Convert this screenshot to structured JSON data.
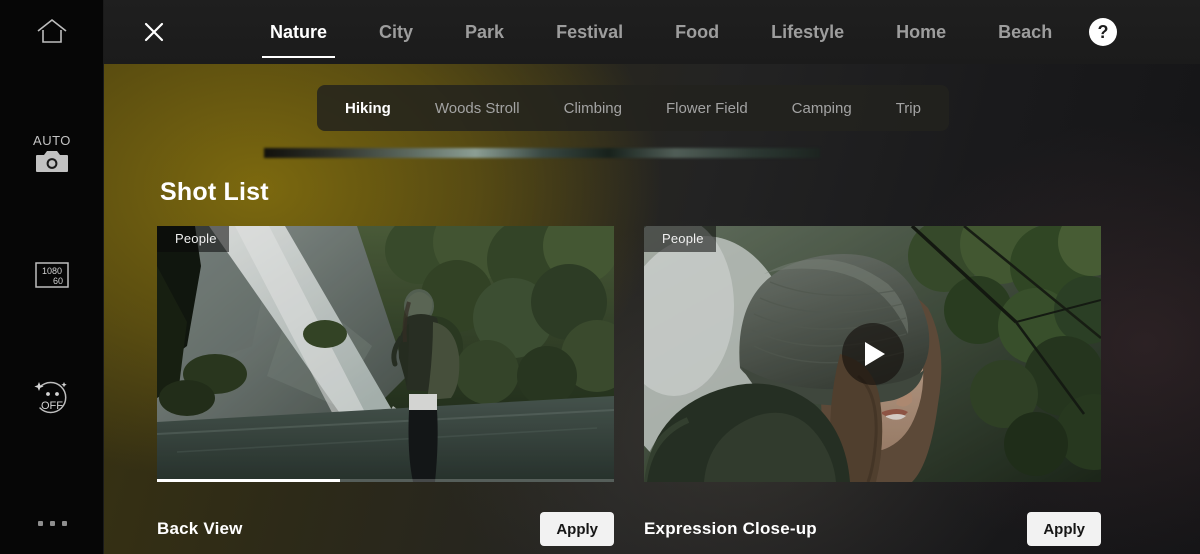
{
  "sidebar": {
    "items": [
      {
        "name": "home",
        "icon": "home-icon",
        "label": ""
      },
      {
        "name": "shooting-mode",
        "icon": "camera-icon",
        "label": "AUTO"
      },
      {
        "name": "video-resolution",
        "icon": "resolution-icon",
        "label_top": "1080",
        "label_bottom": "60"
      },
      {
        "name": "beauty-filter",
        "icon": "face-beauty-icon",
        "label": "OFF"
      },
      {
        "name": "more-options",
        "icon": "more-dots-icon",
        "label": ""
      }
    ]
  },
  "topbar": {
    "close_label": "✕",
    "help_label": "?",
    "tabs": [
      {
        "label": "Nature",
        "active": true
      },
      {
        "label": "City",
        "active": false
      },
      {
        "label": "Park",
        "active": false
      },
      {
        "label": "Festival",
        "active": false
      },
      {
        "label": "Food",
        "active": false
      },
      {
        "label": "Lifestyle",
        "active": false
      },
      {
        "label": "Home",
        "active": false
      },
      {
        "label": "Beach",
        "active": false
      }
    ]
  },
  "subtabs": [
    {
      "label": "Hiking",
      "active": true
    },
    {
      "label": "Woods Stroll",
      "active": false
    },
    {
      "label": "Climbing",
      "active": false
    },
    {
      "label": "Flower Field",
      "active": false
    },
    {
      "label": "Camping",
      "active": false
    },
    {
      "label": "Trip",
      "active": false
    }
  ],
  "main": {
    "section_title": "Shot List",
    "cards": [
      {
        "badge": "People",
        "title": "Back View",
        "apply_label": "Apply",
        "has_play": false,
        "progress_percent": 40
      },
      {
        "badge": "People",
        "title": "Expression Close-up",
        "apply_label": "Apply",
        "has_play": true,
        "progress_percent": 0
      }
    ]
  },
  "colors": {
    "accent_olive": "#6d5c10",
    "topbar": "#1b1b1b",
    "sidebar": "#060606",
    "apply_bg": "#f2f2f2",
    "active_text": "#ffffff",
    "inactive_text": "#9d9d9d"
  }
}
